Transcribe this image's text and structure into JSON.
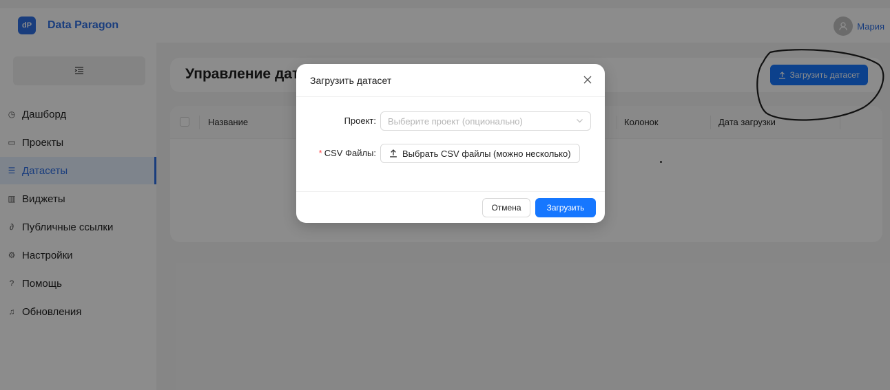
{
  "header": {
    "logo_text": "dP",
    "brand": "Data Paragon",
    "user_name": "Мария"
  },
  "sidebar": {
    "items": [
      {
        "label": "Дашборд",
        "icon": "dashboard-icon",
        "active": false
      },
      {
        "label": "Проекты",
        "icon": "folder-icon",
        "active": false
      },
      {
        "label": "Датасеты",
        "icon": "dataset-icon",
        "active": true
      },
      {
        "label": "Виджеты",
        "icon": "chart-icon",
        "active": false
      },
      {
        "label": "Публичные ссылки",
        "icon": "link-icon",
        "active": false
      },
      {
        "label": "Настройки",
        "icon": "settings-icon",
        "active": false
      },
      {
        "label": "Помощь",
        "icon": "help-icon",
        "active": false
      },
      {
        "label": "Обновления",
        "icon": "bell-icon",
        "active": false
      }
    ]
  },
  "main": {
    "title": "Управление датасетами",
    "upload_button": "Загрузить датасет",
    "table": {
      "columns": [
        "Название",
        "Колонок",
        "Дата загрузки"
      ]
    }
  },
  "modal": {
    "title": "Загрузить датасет",
    "project_label": "Проект:",
    "project_placeholder": "Выберите проект (опционально)",
    "csv_label": "CSV Файлы:",
    "csv_required_mark": "*",
    "csv_button": "Выбрать CSV файлы (можно несколько)",
    "cancel": "Отмена",
    "submit": "Загрузить"
  },
  "colors": {
    "primary": "#1677ff",
    "brand": "#2f6fe4",
    "required": "#ff4d4f"
  }
}
